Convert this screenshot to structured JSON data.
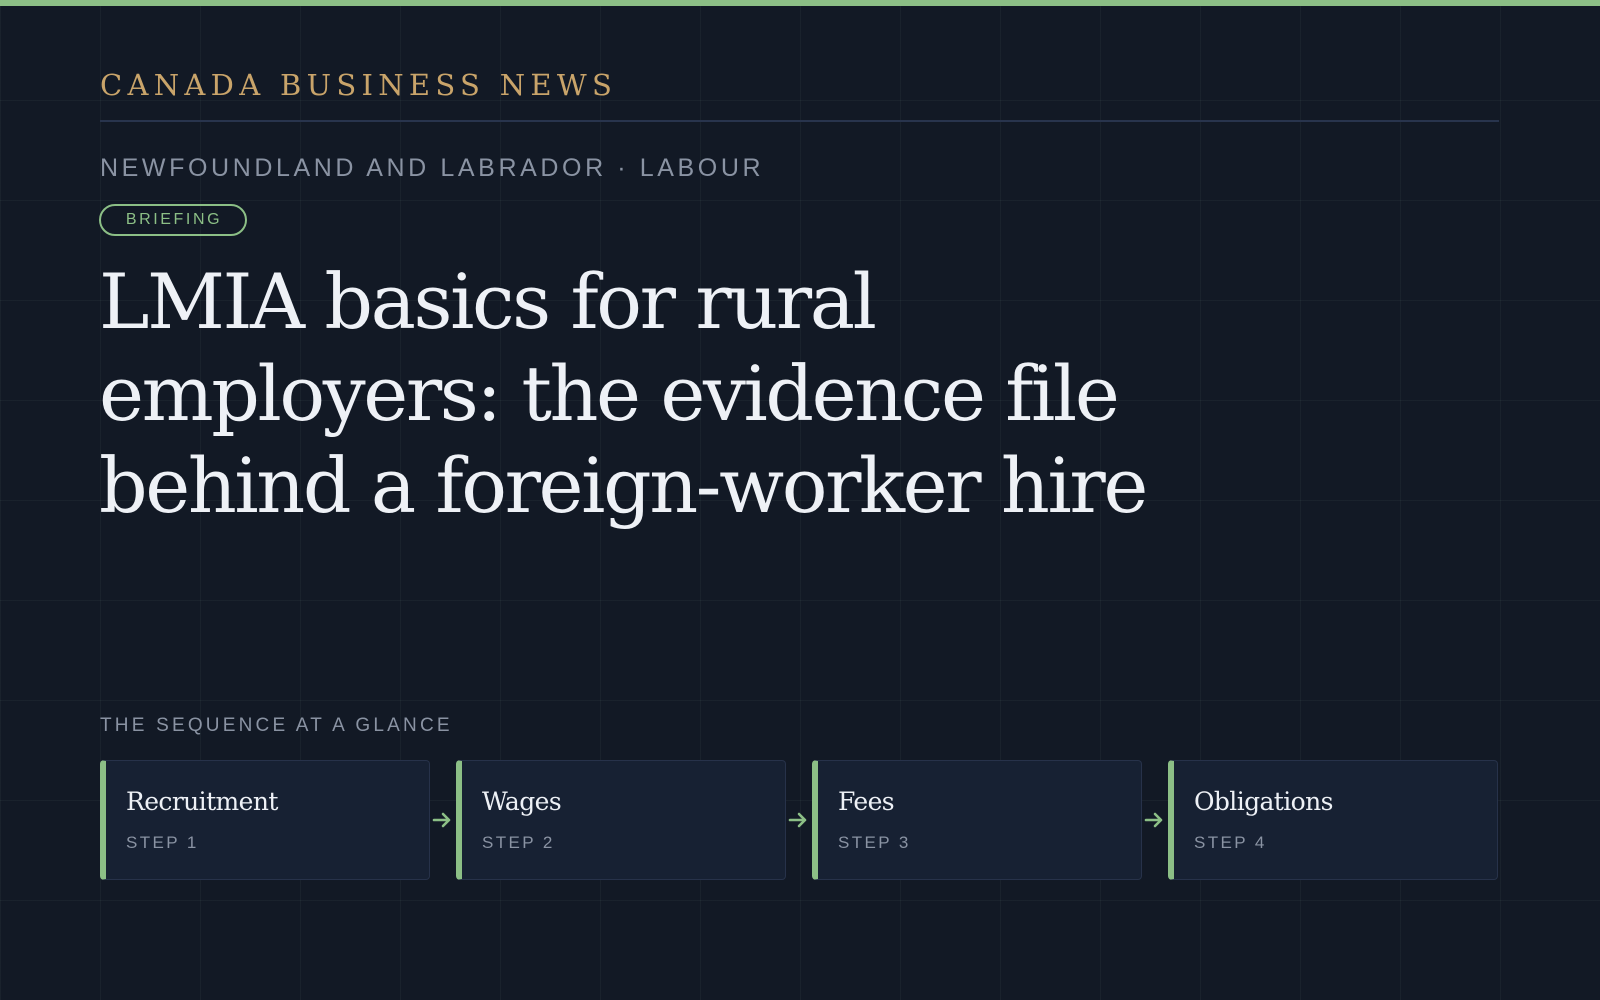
{
  "colors": {
    "background": "#121925",
    "accent_green": "#8cbf86",
    "masthead_gold": "#c9a46a",
    "card_background": "#172133"
  },
  "masthead": {
    "title": "CANADA BUSINESS NEWS"
  },
  "article": {
    "kicker": "NEWFOUNDLAND AND LABRADOR · LABOUR",
    "badge": "BRIEFING",
    "headline": "LMIA basics for rural employers: the evidence file behind a foreign-worker hire"
  },
  "sequence": {
    "label": "THE SEQUENCE AT A GLANCE",
    "arrow_icon": "arrow-right-icon",
    "steps": [
      {
        "title": "Recruitment",
        "step": "STEP 1"
      },
      {
        "title": "Wages",
        "step": "STEP 2"
      },
      {
        "title": "Fees",
        "step": "STEP 3"
      },
      {
        "title": "Obligations",
        "step": "STEP 4"
      }
    ]
  }
}
